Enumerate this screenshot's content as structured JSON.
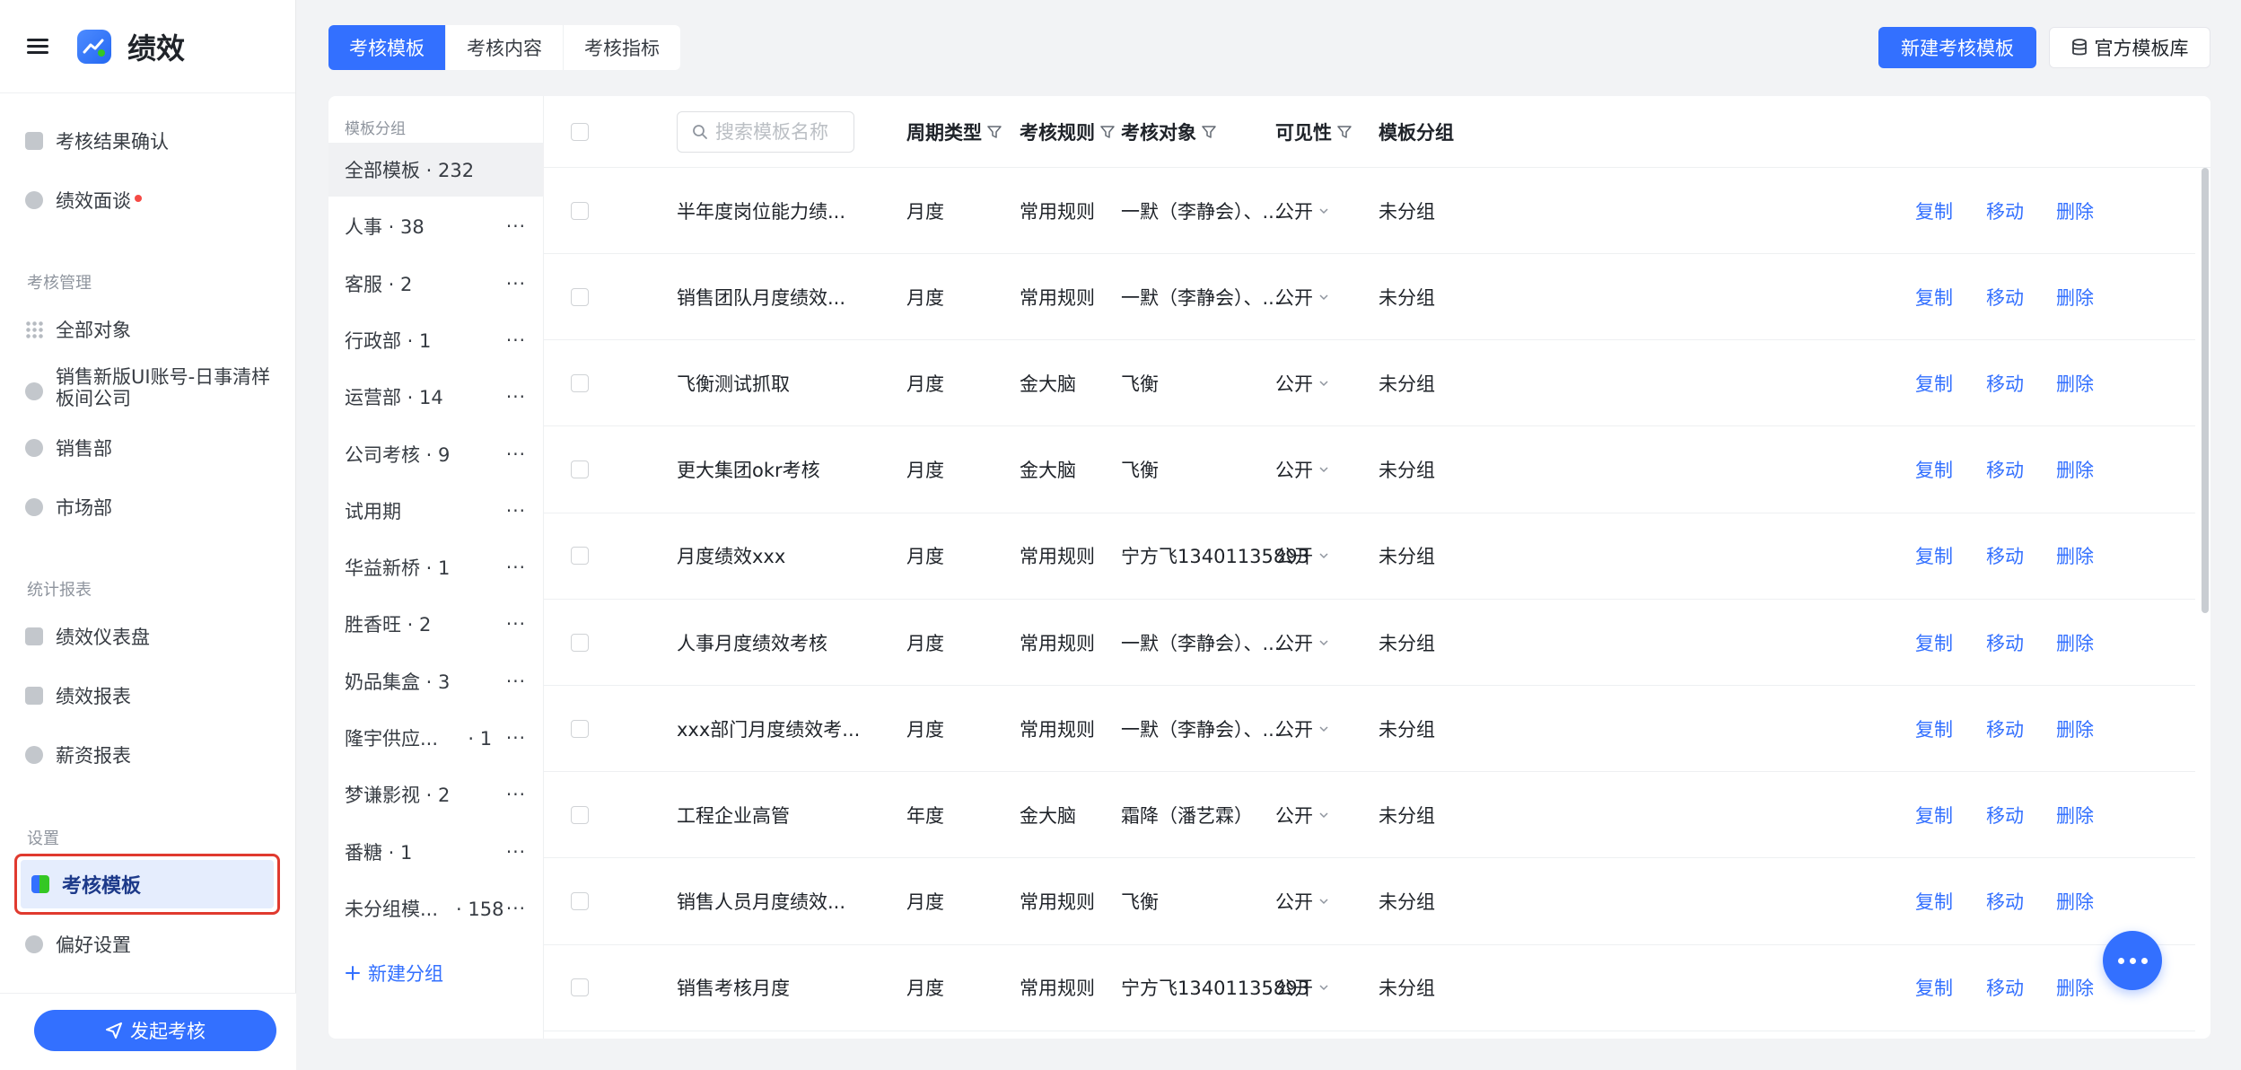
{
  "app": {
    "title": "绩效"
  },
  "sidebar": {
    "top_items": [
      {
        "label": "考核结果确认",
        "icon": "upload-icon"
      },
      {
        "label": "绩效面谈",
        "icon": "chat-icon",
        "badge": "red-dot"
      }
    ],
    "sections": [
      {
        "title": "考核管理",
        "items": [
          "全部对象",
          "销售新版UI账号-日事清样板间公司",
          "销售部",
          "市场部"
        ]
      },
      {
        "title": "统计报表",
        "items": [
          "绩效仪表盘",
          "绩效报表",
          "薪资报表"
        ]
      },
      {
        "title": "设置",
        "items": [
          "考核模板",
          "偏好设置"
        ]
      }
    ],
    "active_item": "考核模板",
    "launch_button": "发起考核"
  },
  "tabs": [
    "考核模板",
    "考核内容",
    "考核指标"
  ],
  "toolbar": {
    "new_template": "新建考核模板",
    "official_library": "官方模板库"
  },
  "groups": {
    "title": "模板分组",
    "items": [
      "全部模板 · 232",
      "人事 · 38",
      "客服 · 2",
      "行政部 · 1",
      "运营部 · 14",
      "公司考核 · 9",
      "试用期",
      "华益新桥 · 1",
      "胜香旺 · 2",
      "奶品集盒 · 3",
      "隆宇供应...     · 1",
      "梦谦影视 · 2",
      "番糖 · 1",
      "未分组模...   · 158"
    ],
    "more": "···",
    "new_group": "新建分组"
  },
  "table": {
    "search_placeholder": "搜索模板名称",
    "headers": {
      "cycle": "周期类型",
      "rule": "考核规则",
      "target": "考核对象",
      "visibility": "可见性",
      "group": "模板分组"
    },
    "actions": {
      "copy": "复制",
      "move": "移动",
      "delete": "删除"
    },
    "rows": [
      {
        "name": "半年度岗位能力绩...",
        "cycle": "月度",
        "rule": "常用规则",
        "target": "一默（李静会）、...",
        "visibility": "公开",
        "group": "未分组"
      },
      {
        "name": "销售团队月度绩效...",
        "cycle": "月度",
        "rule": "常用规则",
        "target": "一默（李静会）、...",
        "visibility": "公开",
        "group": "未分组"
      },
      {
        "name": "飞衡测试抓取",
        "cycle": "月度",
        "rule": "金大脑",
        "target": "飞衡",
        "visibility": "公开",
        "group": "未分组"
      },
      {
        "name": "更大集团okr考核",
        "cycle": "月度",
        "rule": "金大脑",
        "target": "飞衡",
        "visibility": "公开",
        "group": "未分组"
      },
      {
        "name": "月度绩效xxx",
        "cycle": "月度",
        "rule": "常用规则",
        "target": "宁方飞13401135893",
        "visibility": "公开",
        "group": "未分组"
      },
      {
        "name": "人事月度绩效考核",
        "cycle": "月度",
        "rule": "常用规则",
        "target": "一默（李静会）、...",
        "visibility": "公开",
        "group": "未分组"
      },
      {
        "name": "xxx部门月度绩效考...",
        "cycle": "月度",
        "rule": "常用规则",
        "target": "一默（李静会）、...",
        "visibility": "公开",
        "group": "未分组"
      },
      {
        "name": "工程企业高管",
        "cycle": "年度",
        "rule": "金大脑",
        "target": "霜降（潘艺霖）",
        "visibility": "公开",
        "group": "未分组"
      },
      {
        "name": "销售人员月度绩效...",
        "cycle": "月度",
        "rule": "常用规则",
        "target": "飞衡",
        "visibility": "公开",
        "group": "未分组"
      },
      {
        "name": "销售考核月度",
        "cycle": "月度",
        "rule": "常用规则",
        "target": "宁方飞13401135893",
        "visibility": "公开",
        "group": "未分组"
      }
    ]
  },
  "colors": {
    "primary": "#3370ff",
    "highlight_border": "#e03a2f",
    "active_bg": "#e5edfd"
  }
}
